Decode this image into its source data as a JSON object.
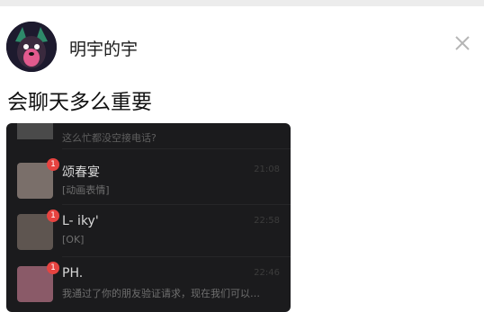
{
  "post": {
    "author": "明宇的宇",
    "title": "会聊天多么重要"
  },
  "chat_list": {
    "first_preview": "这么忙都没空接电话?",
    "items": [
      {
        "name": "颂春宴",
        "preview": "[动画表情]",
        "time": "21:08",
        "badge": "1"
      },
      {
        "name": "L- iky'",
        "preview": "[OK]",
        "time": "22:58",
        "badge": "1"
      },
      {
        "name": "PH.",
        "preview": "我通过了你的朋友验证请求，现在我们可以…",
        "time": "22:46",
        "badge": "1"
      }
    ]
  },
  "colors": {
    "badge": "#e64340",
    "dark_bg": "#1b1b1d"
  },
  "icons": {
    "close": "close-icon"
  }
}
